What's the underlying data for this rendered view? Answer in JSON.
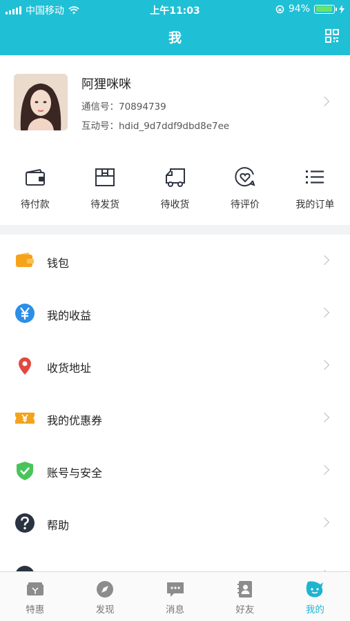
{
  "status": {
    "carrier": "中国移动",
    "time": "上午11:03",
    "battery": "94%",
    "battery_level": 0.94
  },
  "nav": {
    "title": "我",
    "qr_icon": "qr-code-icon"
  },
  "profile": {
    "name": "阿狸咪咪",
    "line1": "通信号：70894739",
    "line2": "互动号：hdid_9d7ddf9dbd8e7ee"
  },
  "orders": [
    {
      "label": "待付款",
      "icon": "wallet-icon"
    },
    {
      "label": "待发货",
      "icon": "package-icon"
    },
    {
      "label": "待收货",
      "icon": "truck-icon"
    },
    {
      "label": "待评价",
      "icon": "review-icon"
    },
    {
      "label": "我的订单",
      "icon": "list-icon"
    }
  ],
  "menu": [
    {
      "label": "钱包",
      "icon": "wallet-icon"
    },
    {
      "label": "我的收益",
      "icon": "yen-icon"
    },
    {
      "label": "收货地址",
      "icon": "location-pin-icon"
    },
    {
      "label": "我的优惠券",
      "icon": "coupon-icon"
    },
    {
      "label": "账号与安全",
      "icon": "shield-icon"
    },
    {
      "label": "帮助",
      "icon": "help-icon"
    }
  ],
  "tabs": [
    {
      "label": "特惠",
      "icon": "deals-icon"
    },
    {
      "label": "发现",
      "icon": "compass-icon"
    },
    {
      "label": "消息",
      "icon": "message-icon"
    },
    {
      "label": "好友",
      "icon": "contacts-icon"
    },
    {
      "label": "我的",
      "icon": "me-icon",
      "active": true
    }
  ],
  "colors": {
    "accent": "#1fc0d6",
    "tab_active": "#1fb4d0",
    "wallet": "#f5a31a",
    "yen": "#2b8ee8",
    "location": "#e2483f",
    "coupon": "#f5a31a",
    "shield": "#49c45a",
    "help": "#2a3342"
  }
}
